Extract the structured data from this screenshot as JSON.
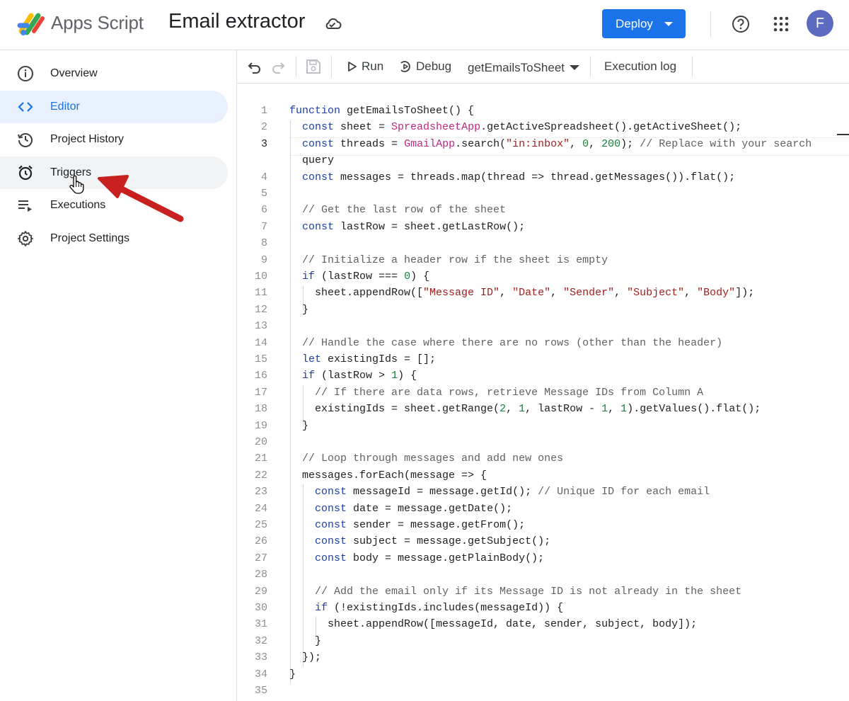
{
  "header": {
    "app_name": "Apps Script",
    "project_title": "Email extractor",
    "deploy_label": "Deploy",
    "avatar_initial": "F",
    "icons": [
      "apps-script-logo",
      "cloud-saved-icon",
      "help-icon",
      "apps-grid-icon"
    ],
    "accent_color": "#1a73e8"
  },
  "sidebar": {
    "items": [
      {
        "label": "Overview",
        "icon": "info-icon",
        "active": false
      },
      {
        "label": "Editor",
        "icon": "code-brackets-icon",
        "active": true
      },
      {
        "label": "Project History",
        "icon": "history-icon",
        "active": false
      },
      {
        "label": "Triggers",
        "icon": "alarm-clock-icon",
        "active": false,
        "hovered": true
      },
      {
        "label": "Executions",
        "icon": "executions-list-icon",
        "active": false
      },
      {
        "label": "Project Settings",
        "icon": "gear-icon",
        "active": false
      }
    ]
  },
  "toolbar": {
    "run_label": "Run",
    "debug_label": "Debug",
    "selected_function": "getEmailsToSheet",
    "execution_log_label": "Execution log",
    "icons": [
      "undo-icon",
      "redo-icon",
      "save-icon",
      "play-icon",
      "debug-icon",
      "dropdown-caret-icon"
    ]
  },
  "editor": {
    "current_line": 3,
    "line_numbers": [
      "1",
      "2",
      "3",
      "",
      "4",
      "5",
      "6",
      "7",
      "8",
      "9",
      "10",
      "11",
      "12",
      "13",
      "14",
      "15",
      "16",
      "17",
      "18",
      "19",
      "20",
      "21",
      "22",
      "23",
      "24",
      "25",
      "26",
      "27",
      "28",
      "29",
      "30",
      "31",
      "32",
      "33",
      "34",
      "35"
    ],
    "lines": [
      "function getEmailsToSheet() {",
      "  const sheet = SpreadsheetApp.getActiveSpreadsheet().getActiveSheet();",
      "  const threads = GmailApp.search(\"in:inbox\", 0, 200); // Replace with your search",
      "  query",
      "  const messages = threads.map(thread => thread.getMessages()).flat();",
      "",
      "  // Get the last row of the sheet",
      "  const lastRow = sheet.getLastRow();",
      "",
      "  // Initialize a header row if the sheet is empty",
      "  if (lastRow === 0) {",
      "    sheet.appendRow([\"Message ID\", \"Date\", \"Sender\", \"Subject\", \"Body\"]);",
      "  }",
      "",
      "  // Handle the case where there are no rows (other than the header)",
      "  let existingIds = [];",
      "  if (lastRow > 1) {",
      "    // If there are data rows, retrieve Message IDs from Column A",
      "    existingIds = sheet.getRange(2, 1, lastRow - 1, 1).getValues().flat();",
      "  }",
      "",
      "  // Loop through messages and add new ones",
      "  messages.forEach(message => {",
      "    const messageId = message.getId(); // Unique ID for each email",
      "    const date = message.getDate();",
      "    const sender = message.getFrom();",
      "    const subject = message.getSubject();",
      "    const body = message.getPlainBody();",
      "",
      "    // Add the email only if its Message ID is not already in the sheet",
      "    if (!existingIds.includes(messageId)) {",
      "      sheet.appendRow([messageId, date, sender, subject, body]);",
      "    }",
      "  });",
      "}",
      ""
    ]
  },
  "annotation": {
    "arrow_color": "#c8201e",
    "points_to": "Triggers",
    "cursor": "hand-pointer-icon"
  }
}
